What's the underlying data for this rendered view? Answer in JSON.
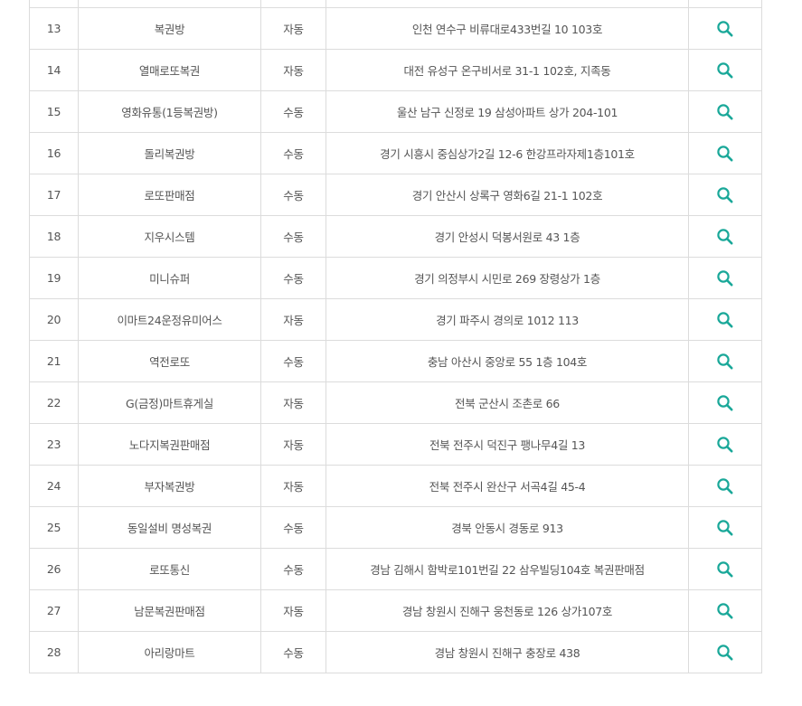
{
  "colors": {
    "accent": "#1aa899",
    "border": "#dcdcdc",
    "text": "#555555"
  },
  "stores": {
    "rows": [
      {
        "no": "13",
        "name": "복권방",
        "type": "자동",
        "address": "인천 연수구 비류대로433번길 10 103호",
        "icon": "search-icon"
      },
      {
        "no": "14",
        "name": "열매로또복권",
        "type": "자동",
        "address": "대전 유성구 온구비서로 31-1 102호, 지족동",
        "icon": "search-icon"
      },
      {
        "no": "15",
        "name": "영화유통(1등복권방)",
        "type": "수동",
        "address": "울산 남구 신정로 19 삼성아파트 상가 204-101",
        "icon": "search-icon"
      },
      {
        "no": "16",
        "name": "돌리복권방",
        "type": "수동",
        "address": "경기 시흥시 중심상가2길 12-6 한강프라자제1층101호",
        "icon": "search-icon"
      },
      {
        "no": "17",
        "name": "로또판매점",
        "type": "수동",
        "address": "경기 안산시 상록구 영화6길 21-1 102호",
        "icon": "search-icon"
      },
      {
        "no": "18",
        "name": "지우시스템",
        "type": "수동",
        "address": "경기 안성시 덕봉서원로 43 1층",
        "icon": "search-icon"
      },
      {
        "no": "19",
        "name": "미니슈퍼",
        "type": "수동",
        "address": "경기 의정부시 시민로 269 장령상가 1층",
        "icon": "search-icon"
      },
      {
        "no": "20",
        "name": "이마트24운정유미어스",
        "type": "자동",
        "address": "경기 파주시 경의로 1012 113",
        "icon": "search-icon"
      },
      {
        "no": "21",
        "name": "역전로또",
        "type": "수동",
        "address": "충남 아산시 중앙로 55 1층 104호",
        "icon": "search-icon"
      },
      {
        "no": "22",
        "name": "G(금정)마트휴게실",
        "type": "자동",
        "address": "전북 군산시 조촌로 66",
        "icon": "search-icon"
      },
      {
        "no": "23",
        "name": "노다지복권판매점",
        "type": "자동",
        "address": "전북 전주시 덕진구 팽나무4길 13",
        "icon": "search-icon"
      },
      {
        "no": "24",
        "name": "부자복권방",
        "type": "자동",
        "address": "전북 전주시 완산구 서곡4길 45-4",
        "icon": "search-icon"
      },
      {
        "no": "25",
        "name": "동일설비 명성복권",
        "type": "수동",
        "address": "경북 안동시 경동로 913",
        "icon": "search-icon"
      },
      {
        "no": "26",
        "name": "로또통신",
        "type": "수동",
        "address": "경남 김해시 함박로101번길 22 삼우빌딩104호 복권판매점",
        "icon": "search-icon"
      },
      {
        "no": "27",
        "name": "남문복권판매점",
        "type": "자동",
        "address": "경남 창원시 진해구 웅천동로 126 상가107호",
        "icon": "search-icon"
      },
      {
        "no": "28",
        "name": "아리랑마트",
        "type": "수동",
        "address": "경남 창원시 진해구 충장로 438",
        "icon": "search-icon"
      }
    ]
  }
}
